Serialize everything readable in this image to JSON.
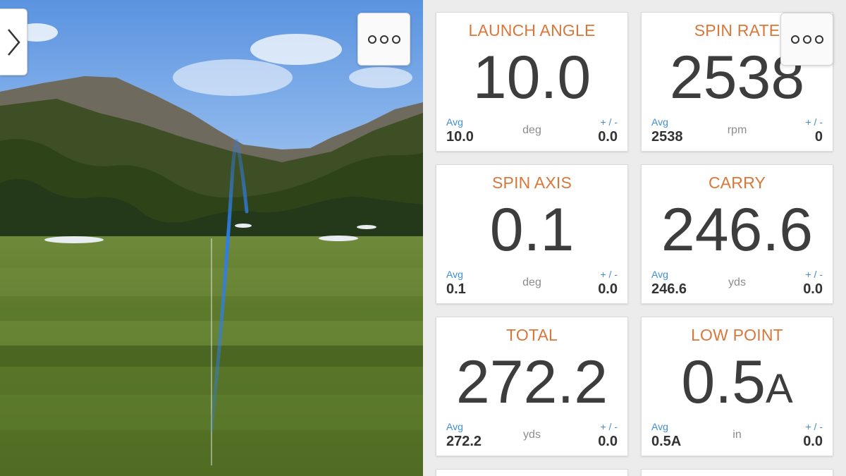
{
  "scene": {
    "expand_icon": "chevron-right-icon",
    "more_icon": "more-options-icon"
  },
  "metrics": [
    {
      "title": "LAUNCH ANGLE",
      "value": "10.0",
      "suffix": "",
      "avg_label": "Avg",
      "avg": "10.0",
      "unit": "deg",
      "pm_label": "+ / -",
      "pm": "0.0"
    },
    {
      "title": "SPIN RATE",
      "value": "2538",
      "suffix": "",
      "avg_label": "Avg",
      "avg": "2538",
      "unit": "rpm",
      "pm_label": "+ / -",
      "pm": "0"
    },
    {
      "title": "SPIN AXIS",
      "value": "0.1",
      "suffix": "",
      "avg_label": "Avg",
      "avg": "0.1",
      "unit": "deg",
      "pm_label": "+ / -",
      "pm": "0.0"
    },
    {
      "title": "CARRY",
      "value": "246.6",
      "suffix": "",
      "avg_label": "Avg",
      "avg": "246.6",
      "unit": "yds",
      "pm_label": "+ / -",
      "pm": "0.0"
    },
    {
      "title": "TOTAL",
      "value": "272.2",
      "suffix": "",
      "avg_label": "Avg",
      "avg": "272.2",
      "unit": "yds",
      "pm_label": "+ / -",
      "pm": "0.0"
    },
    {
      "title": "LOW POINT",
      "value": "0.5",
      "suffix": "A",
      "avg_label": "Avg",
      "avg": "0.5A",
      "unit": "in",
      "pm_label": "+ / -",
      "pm": "0.0"
    }
  ],
  "colors": {
    "title": "#d9773a",
    "label": "#3e8ed6",
    "value": "#3d3d3d",
    "shot_tracer": "#2f7ee8"
  }
}
